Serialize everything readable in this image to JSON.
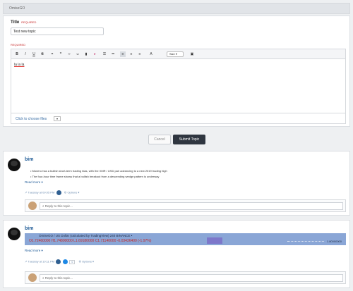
{
  "topbar": {
    "label": "OmiseGO"
  },
  "form": {
    "title_label": "Title",
    "required_badge": "REQUIRED",
    "title_value": "Test new topic",
    "required_badge2": "REQUIRED",
    "toolbar": {
      "bold": "B",
      "italic": "I",
      "underline": "U",
      "strike": "S",
      "link": "⚭",
      "quote": "❞",
      "code": "‹›",
      "emoji": "☺",
      "image": "▮",
      "color": "◕",
      "ul": "☰",
      "ol": "≔",
      "align_left": "≡",
      "align_center": "≡",
      "align_right": "≡",
      "fontsize": "A",
      "size_label": "Size ▾",
      "save": "▣"
    },
    "content": "la la la",
    "choose_files": "Click to choose files",
    "choose_files_dropdown": "▾"
  },
  "actions": {
    "cancel": "Cancel",
    "submit": "Submit Topic"
  },
  "posts": [
    {
      "user": "bim",
      "bullets": [
        "Monero has a bullish short-term trading bias, with the XMR / USD pair advancing to a new 2019 trading high",
        "The four-hour time frame shows that a bullish breakout from a descending wedge pattern is underway"
      ],
      "read_more": "Read more ▾",
      "date": "Tuesday at 09:05 PM",
      "options": "⚙ Options ▾",
      "reply_placeholder": "⌕ Reply to this topic..."
    },
    {
      "user": "bim",
      "chart_line1": "OmiseGO / US Dollar (calculated by TradingView)  240  BINANCE •",
      "chart_line2": "O1.72460000 H1.74800000 L1.69180000 C1.71140000 -0.03436400 (-1.97%)",
      "chart_axis_value": "1.80000000",
      "read_more": "Read more ▾",
      "date": "Tuesday at 10:11 PM",
      "badge_count": "0",
      "options": "⚙ Options ▾",
      "reply_placeholder": "⌕ Reply to this topic..."
    }
  ]
}
